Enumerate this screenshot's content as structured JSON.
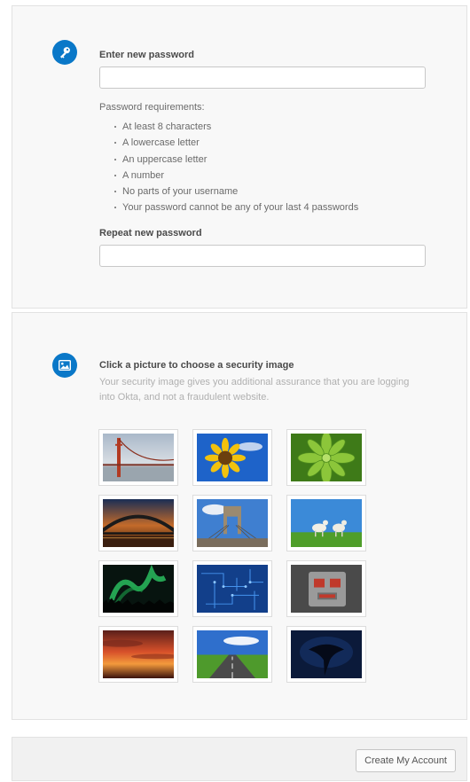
{
  "password_section": {
    "title": "Enter new password",
    "new_password_value": "",
    "requirements_heading": "Password requirements:",
    "requirements": [
      "At least 8 characters",
      "A lowercase letter",
      "An uppercase letter",
      "A number",
      "No parts of your username",
      "Your password cannot be any of your last 4 passwords"
    ],
    "repeat_title": "Repeat new password",
    "repeat_password_value": "",
    "icon": "key-icon"
  },
  "security_image_section": {
    "title": "Click a picture to choose a security image",
    "description": "Your security image gives you additional assurance that you are logging into Okta, and not a fraudulent website.",
    "icon": "picture-icon",
    "images": [
      "golden-gate-bridge-fog",
      "sunflower",
      "green-succulent",
      "harbour-bridge-sunset",
      "brooklyn-bridge",
      "lambs-on-grass",
      "aurora-borealis",
      "blue-circuit-board",
      "robot-toy",
      "red-sunset-clouds",
      "open-road",
      "manta-ray"
    ]
  },
  "footer": {
    "create_button_label": "Create My Account"
  },
  "colors": {
    "accent": "#0a78c8",
    "panel_background": "#f8f8f8"
  }
}
